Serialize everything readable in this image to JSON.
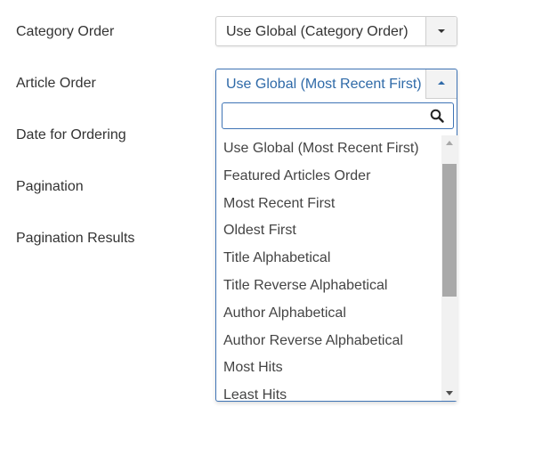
{
  "fields": [
    {
      "label": "Category Order"
    },
    {
      "label": "Article Order"
    },
    {
      "label": "Date for Ordering"
    },
    {
      "label": "Pagination"
    },
    {
      "label": "Pagination Results"
    }
  ],
  "category_order": {
    "value": "Use Global (Category Order)"
  },
  "article_order": {
    "value": "Use Global (Most Recent First)",
    "search": {
      "value": "",
      "placeholder": ""
    },
    "options": [
      "Use Global (Most Recent First)",
      "Featured Articles Order",
      "Most Recent First",
      "Oldest First",
      "Title Alphabetical",
      "Title Reverse Alphabetical",
      "Author Alphabetical",
      "Author Reverse Alphabetical",
      "Most Hits",
      "Least Hits"
    ],
    "scroll": {
      "thumb_start_fraction": 0.06,
      "thumb_size_fraction": 0.5
    }
  },
  "colors": {
    "accent": "#3f74b5",
    "selected_text": "#2f6aa8"
  }
}
